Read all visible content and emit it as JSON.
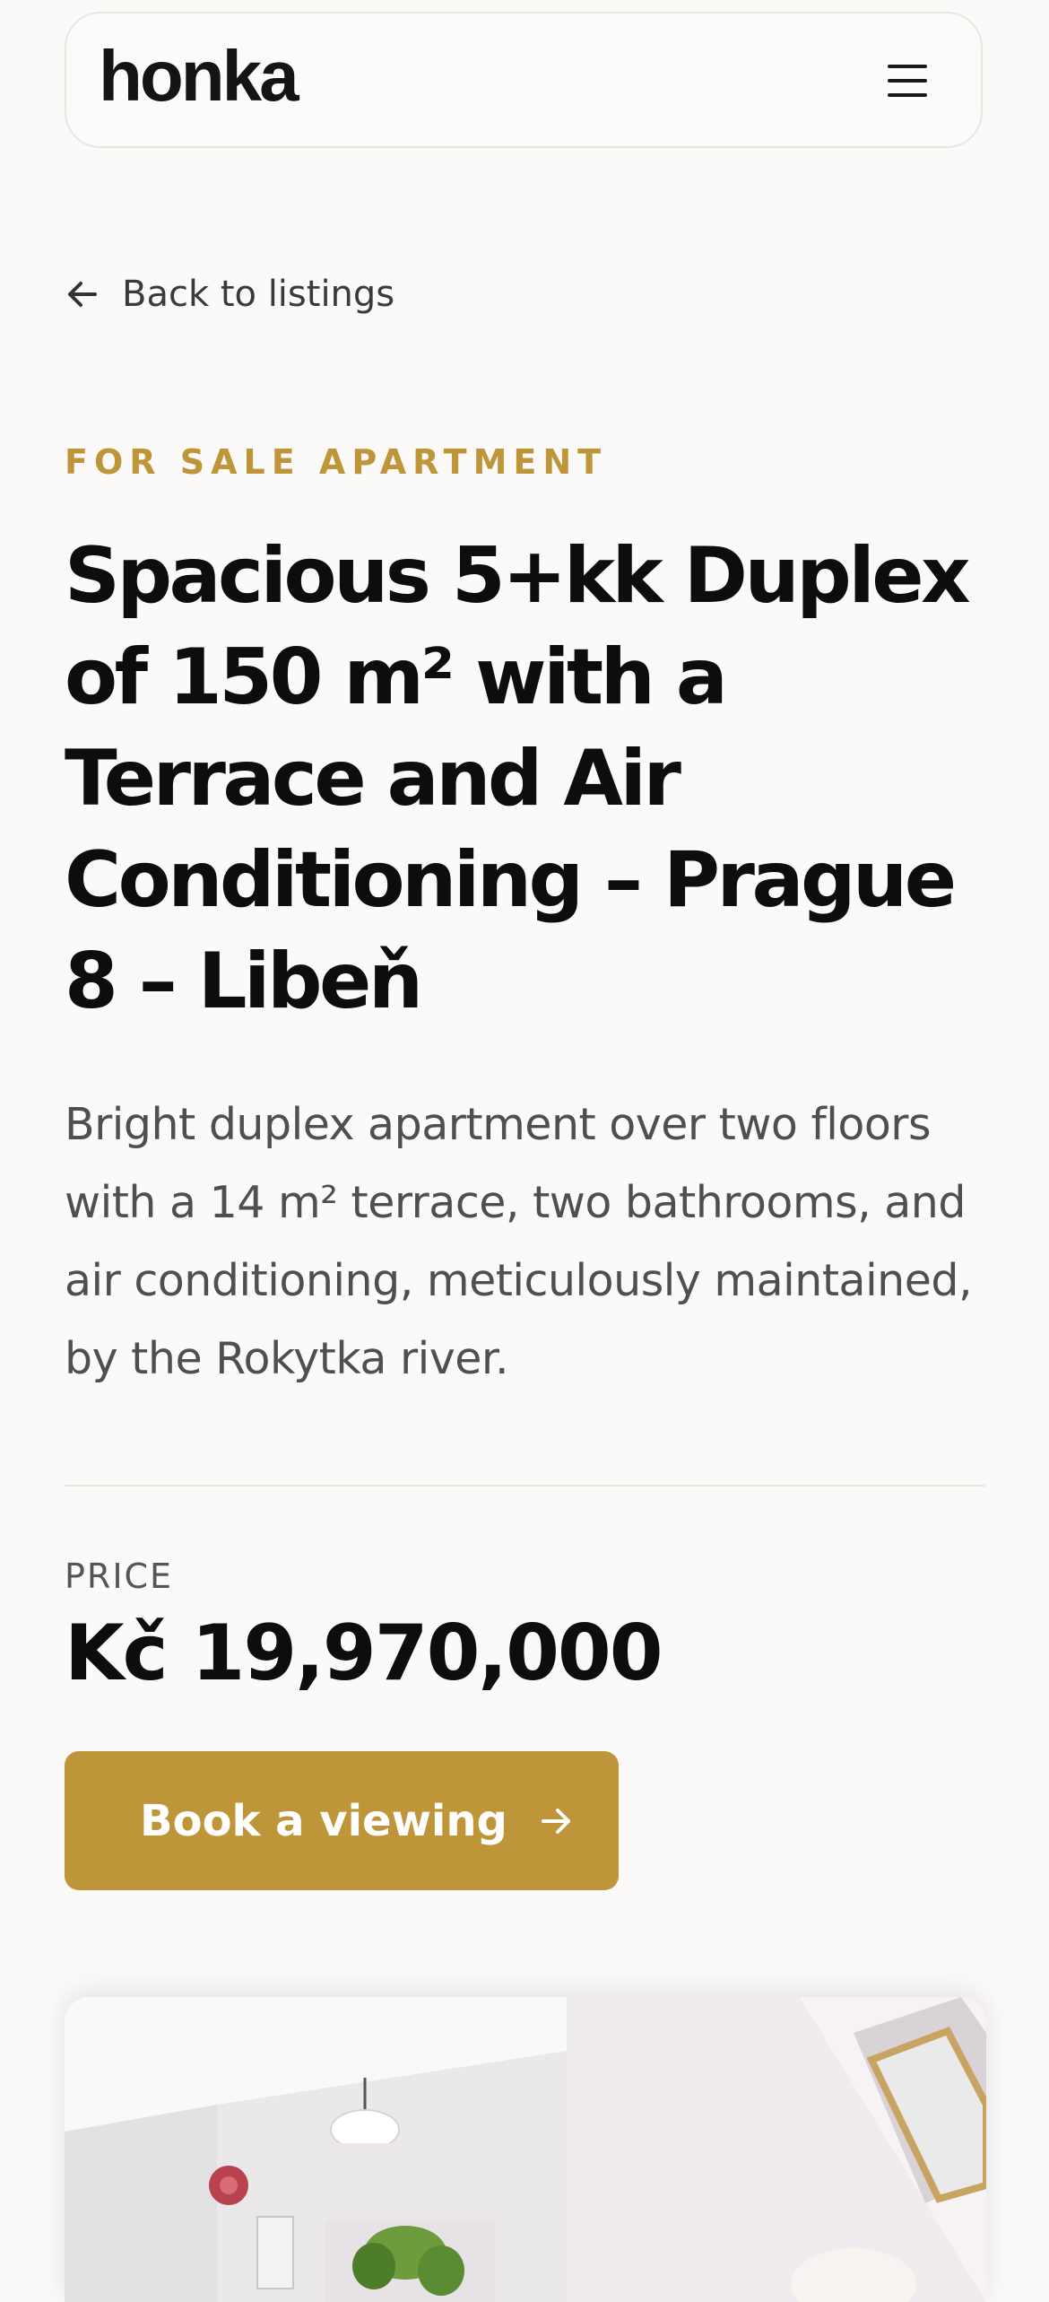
{
  "header": {
    "logo_text": "honka",
    "menu_icon": "hamburger-menu-icon"
  },
  "back_link": {
    "label": "Back to listings",
    "icon": "arrow-left-icon"
  },
  "listing": {
    "eyebrow": "FOR SALE APARTMENT",
    "title": "Spacious 5+kk Duplex of 150 m² with a Terrace and Air Conditioning – Prague 8 – Libeň",
    "description": "Bright duplex apartment over two floors with a 14 m² terrace, two bathrooms, and air conditioning, meticulously maintained, by the Rokytka river."
  },
  "price": {
    "label": "PRICE",
    "value": "Kč 19,970,000"
  },
  "cta": {
    "label": "Book a viewing",
    "icon": "arrow-right-icon"
  },
  "colors": {
    "accent": "#bf953a",
    "background": "#fbfaf9",
    "text": "#0d0d0d"
  }
}
